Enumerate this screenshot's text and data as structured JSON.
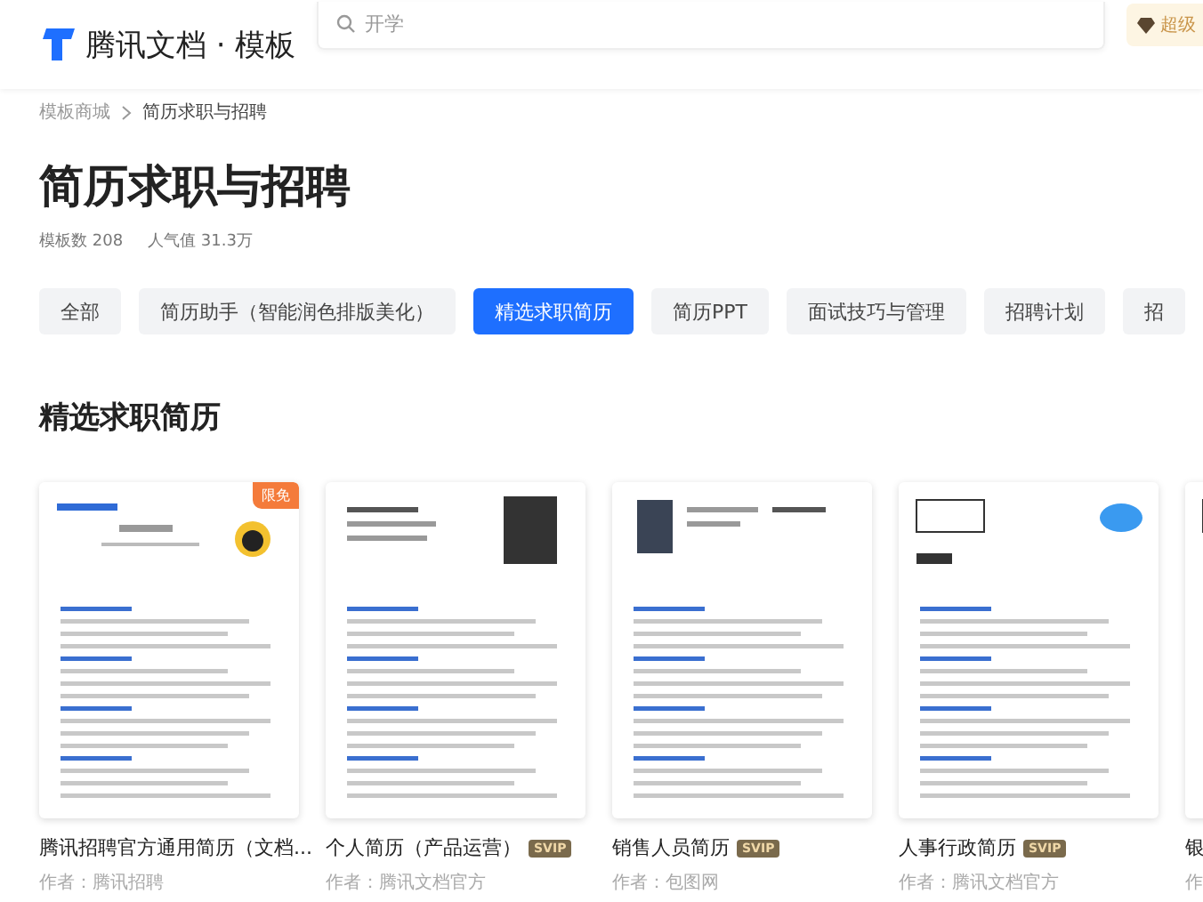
{
  "header": {
    "logo_text": "腾讯文档 · 模板",
    "search": {
      "placeholder": "开学"
    },
    "vip_badge": "超级"
  },
  "breadcrumb": [
    "模板商城",
    "简历求职与招聘"
  ],
  "title": "简历求职与招聘",
  "stats": [
    "模板数 208",
    "人气值 31.3万"
  ],
  "tabs": [
    {
      "label": "全部",
      "selected": false
    },
    {
      "label": "简历助手（智能润色排版美化）",
      "selected": false
    },
    {
      "label": "精选求职简历",
      "selected": true
    },
    {
      "label": "简历PPT",
      "selected": false
    },
    {
      "label": "面试技巧与管理",
      "selected": false
    },
    {
      "label": "招聘计划",
      "selected": false
    },
    {
      "label": "招",
      "selected": false
    }
  ],
  "section_title": "精选求职简历",
  "cards": [
    {
      "kind": "logo",
      "corner_tag": "限免",
      "title": "腾讯招聘官方通用简历（文档...",
      "author": "作者：腾讯招聘"
    },
    {
      "kind": "photo-right",
      "badge": "SVIP",
      "title": "个人简历（产品运营）",
      "author": "作者：腾讯文档官方"
    },
    {
      "kind": "photo-left",
      "badge": "SVIP",
      "title": "销售人员简历",
      "author": "作者：包图网"
    },
    {
      "kind": "plain",
      "badge": "SVIP",
      "title": "人事行政简历",
      "author": "作者：腾讯文档官方"
    },
    {
      "kind": "plain",
      "title": "银",
      "author": "作"
    }
  ]
}
